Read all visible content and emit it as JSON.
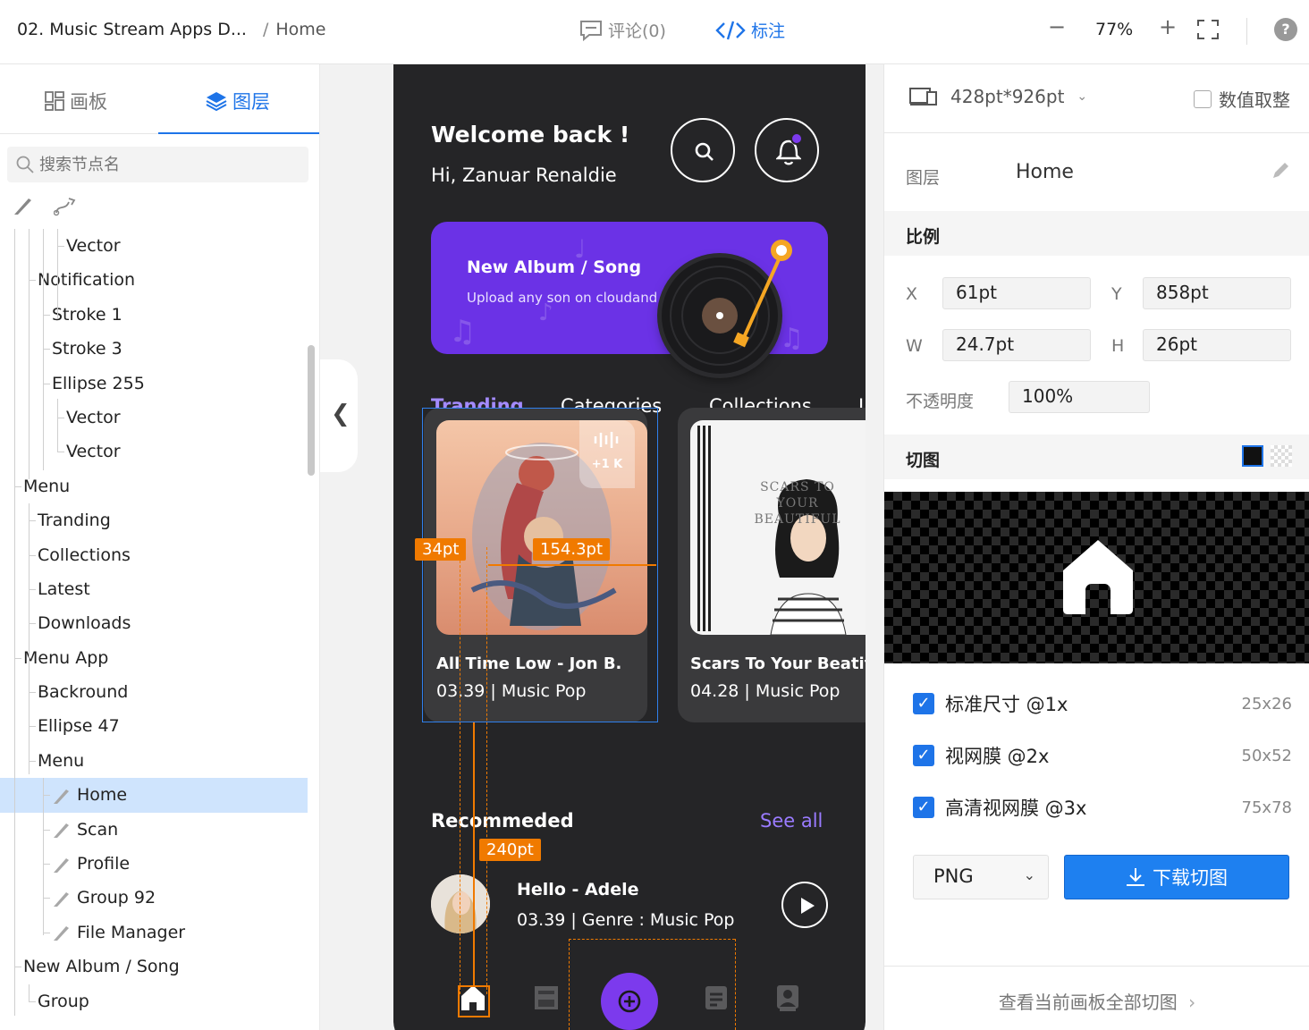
{
  "topbar": {
    "project": "02. Music Stream Apps D...",
    "separator": "/",
    "page": "Home",
    "comment": "评论(0)",
    "annotate": "标注",
    "zoom": "77%",
    "minus": "−",
    "plus": "+",
    "help": "?"
  },
  "left": {
    "tab_board": "画板",
    "tab_layer": "图层",
    "search_placeholder": "搜索节点名",
    "tree": [
      {
        "label": "Vector",
        "depth": 4
      },
      {
        "label": "Notification",
        "depth": 2
      },
      {
        "label": "Stroke 1",
        "depth": 3
      },
      {
        "label": "Stroke 3",
        "depth": 3
      },
      {
        "label": "Ellipse 255",
        "depth": 3
      },
      {
        "label": "Vector",
        "depth": 4
      },
      {
        "label": "Vector",
        "depth": 4
      },
      {
        "label": "Menu",
        "depth": 1
      },
      {
        "label": "Tranding",
        "depth": 2
      },
      {
        "label": "Collections",
        "depth": 2
      },
      {
        "label": "Latest",
        "depth": 2
      },
      {
        "label": "Downloads",
        "depth": 2
      },
      {
        "label": "Menu App",
        "depth": 1
      },
      {
        "label": "Backround",
        "depth": 2
      },
      {
        "label": "Ellipse 47",
        "depth": 2
      },
      {
        "label": "Menu",
        "depth": 2
      },
      {
        "label": "Home",
        "depth": 3,
        "icon": "slice",
        "selected": true
      },
      {
        "label": "Scan",
        "depth": 3,
        "icon": "slice"
      },
      {
        "label": "Profile",
        "depth": 3,
        "icon": "slice"
      },
      {
        "label": "Group 92",
        "depth": 3,
        "icon": "slice"
      },
      {
        "label": "File Manager",
        "depth": 3,
        "icon": "slice"
      },
      {
        "label": "New Album / Song",
        "depth": 1
      },
      {
        "label": "Group",
        "depth": 2
      }
    ]
  },
  "phone": {
    "welcome": "Welcome back !",
    "greeting": "Hi, Zanuar Renaldie",
    "banner_title": "New Album / Song",
    "banner_sub": "Upload any son on cloudand s",
    "tabs": [
      "Tranding",
      "Categories",
      "Collections",
      "L"
    ],
    "cards": [
      {
        "title": "All Time Low - Jon B.",
        "meta": "03.39 | Music Pop",
        "badge": "+1 K"
      },
      {
        "title": "Scars To Your Beatif",
        "meta": "04.28 | Music Pop",
        "art_text": "SCARS TO YOUR BEAUTIFUL"
      }
    ],
    "recommended": "Recommeded",
    "see_all": "See all",
    "rec_title": "Hello - Adele",
    "rec_meta": "03.39 | Genre : Music Pop"
  },
  "measure": {
    "left": "34pt",
    "width": "154.3pt",
    "height": "240pt"
  },
  "right": {
    "device": "428pt*926pt",
    "round_values": "数值取整",
    "layer_label": "图层",
    "layer_name": "Home",
    "section_scale": "比例",
    "x_label": "X",
    "x": "61pt",
    "y_label": "Y",
    "y": "858pt",
    "w_label": "W",
    "w": "24.7pt",
    "h_label": "H",
    "h": "26pt",
    "opacity_label": "不透明度",
    "opacity": "100%",
    "section_slice": "切图",
    "exports": [
      {
        "label": "标准尺寸 @1x",
        "size": "25x26"
      },
      {
        "label": "视网膜 @2x",
        "size": "50x52"
      },
      {
        "label": "高清视网膜 @3x",
        "size": "75x78"
      }
    ],
    "format": "PNG",
    "download": "下载切图",
    "view_all": "查看当前画板全部切图"
  },
  "colors": {
    "accent": "#1e74e8",
    "purple": "#6b32e6",
    "measure": "#f07a00",
    "phone_bg": "#252527"
  }
}
